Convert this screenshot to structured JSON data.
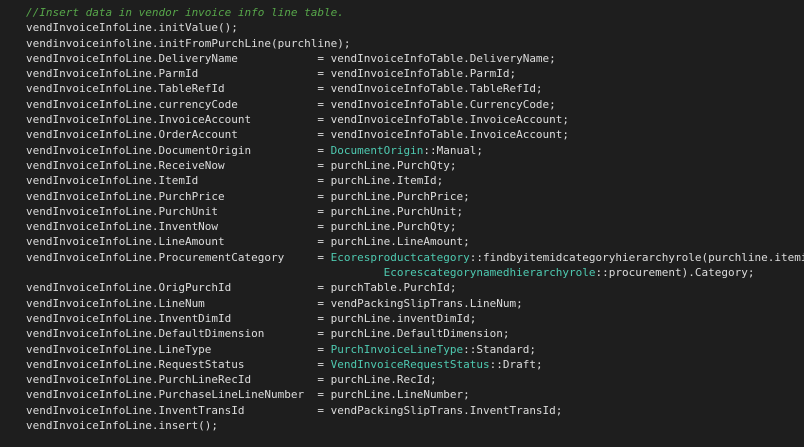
{
  "editor": {
    "lines": [
      {
        "segments": [
          {
            "text": "//Insert data in vendor invoice info line table.",
            "kind": "comment"
          }
        ]
      },
      {
        "segments": [
          {
            "text": "vendInvoiceInfoLine.initValue();",
            "kind": "plain"
          }
        ]
      },
      {
        "segments": [
          {
            "text": "vendinvoiceinfoline.initFromPurchLine(purchline);",
            "kind": "plain"
          }
        ]
      },
      {
        "segments": [
          {
            "text": "vendInvoiceInfoLine.DeliveryName            = vendInvoiceInfoTable.DeliveryName;",
            "kind": "plain"
          }
        ]
      },
      {
        "segments": [
          {
            "text": "vendInvoiceInfoLine.ParmId                  = vendInvoiceInfoTable.ParmId;",
            "kind": "plain"
          }
        ]
      },
      {
        "segments": [
          {
            "text": "vendInvoiceInfoLine.TableRefId              = vendInvoiceInfoTable.TableRefId;",
            "kind": "plain"
          }
        ]
      },
      {
        "segments": [
          {
            "text": "vendInvoiceInfoLine.currencyCode            = vendInvoiceInfoTable.CurrencyCode;",
            "kind": "plain"
          }
        ]
      },
      {
        "segments": [
          {
            "text": "vendInvoiceInfoLine.InvoiceAccount          = vendInvoiceInfoTable.InvoiceAccount;",
            "kind": "plain"
          }
        ]
      },
      {
        "segments": [
          {
            "text": "vendInvoiceInfoLine.OrderAccount            = vendInvoiceInfoTable.InvoiceAccount;",
            "kind": "plain"
          }
        ]
      },
      {
        "segments": [
          {
            "text": "vendInvoiceInfoLine.DocumentOrigin          = ",
            "kind": "plain"
          },
          {
            "text": "DocumentOrigin",
            "kind": "type"
          },
          {
            "text": "::Manual;",
            "kind": "plain"
          }
        ]
      },
      {
        "segments": [
          {
            "text": "vendInvoiceInfoLine.ReceiveNow              = purchLine.PurchQty;",
            "kind": "plain"
          }
        ]
      },
      {
        "segments": [
          {
            "text": "vendInvoiceInfoLine.ItemId                  = purchLine.ItemId;",
            "kind": "plain"
          }
        ]
      },
      {
        "segments": [
          {
            "text": "vendInvoiceInfoLine.PurchPrice              = purchLine.PurchPrice;",
            "kind": "plain"
          }
        ]
      },
      {
        "segments": [
          {
            "text": "vendInvoiceInfoLine.PurchUnit               = purchLine.PurchUnit;",
            "kind": "plain"
          }
        ]
      },
      {
        "segments": [
          {
            "text": "vendInvoiceInfoLine.InventNow               = purchLine.PurchQty;",
            "kind": "plain"
          }
        ]
      },
      {
        "segments": [
          {
            "text": "vendInvoiceInfoLine.LineAmount              = purchLine.LineAmount;",
            "kind": "plain"
          }
        ]
      },
      {
        "segments": [
          {
            "text": "vendInvoiceInfoLine.ProcurementCategory     = ",
            "kind": "plain"
          },
          {
            "text": "Ecoresproductcategory",
            "kind": "type"
          },
          {
            "text": "::findbyitemidcategoryhierarchyrole(purchline.itemid,",
            "kind": "plain"
          }
        ]
      },
      {
        "segments": [
          {
            "text": "                                                      ",
            "kind": "plain"
          },
          {
            "text": "Ecorescategorynamedhierarchyrole",
            "kind": "type"
          },
          {
            "text": "::procurement).Category;",
            "kind": "plain"
          }
        ]
      },
      {
        "segments": [
          {
            "text": "vendInvoiceInfoLine.OrigPurchId             = purchTable.PurchId;",
            "kind": "plain"
          }
        ]
      },
      {
        "segments": [
          {
            "text": "vendInvoiceInfoLine.LineNum                 = vendPackingSlipTrans.LineNum;",
            "kind": "plain"
          }
        ]
      },
      {
        "segments": [
          {
            "text": "vendInvoiceInfoLine.InventDimId             = purchLine.inventDimId;",
            "kind": "plain"
          }
        ]
      },
      {
        "segments": [
          {
            "text": "vendInvoiceInfoLine.DefaultDimension        = purchLine.DefaultDimension;",
            "kind": "plain"
          }
        ]
      },
      {
        "segments": [
          {
            "text": "vendInvoiceInfoLine.LineType                = ",
            "kind": "plain"
          },
          {
            "text": "PurchInvoiceLineType",
            "kind": "type"
          },
          {
            "text": "::Standard;",
            "kind": "plain"
          }
        ]
      },
      {
        "segments": [
          {
            "text": "vendInvoiceInfoLine.RequestStatus           = ",
            "kind": "plain"
          },
          {
            "text": "VendInvoiceRequestStatus",
            "kind": "type"
          },
          {
            "text": "::Draft;",
            "kind": "plain"
          }
        ]
      },
      {
        "segments": [
          {
            "text": "vendInvoiceInfoLine.PurchLineRecId          = purchLine.RecId;",
            "kind": "plain"
          }
        ]
      },
      {
        "segments": [
          {
            "text": "vendInvoiceInfoLine.PurchaseLineLineNumber  = purchLine.LineNumber;",
            "kind": "plain"
          }
        ]
      },
      {
        "segments": [
          {
            "text": "vendInvoiceInfoLine.InventTransId           = vendPackingSlipTrans.InventTransId;",
            "kind": "plain"
          }
        ]
      },
      {
        "segments": [
          {
            "text": "vendInvoiceInfoLine.insert();",
            "kind": "plain"
          }
        ]
      }
    ]
  }
}
